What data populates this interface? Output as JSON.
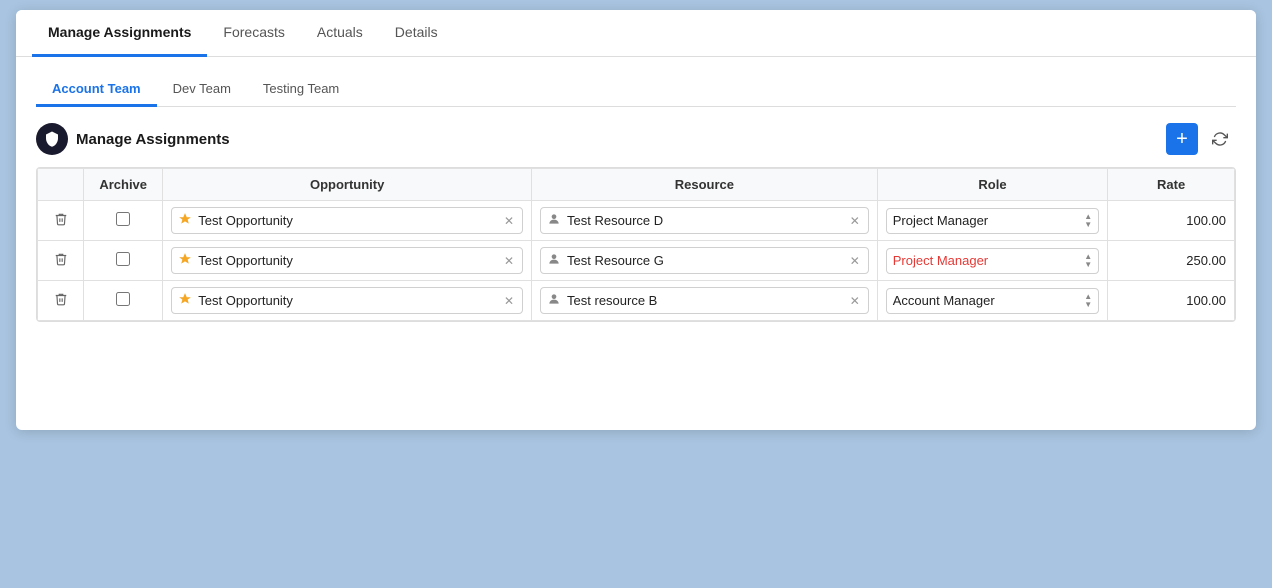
{
  "top_nav": {
    "items": [
      {
        "label": "Manage Assignments",
        "active": true
      },
      {
        "label": "Forecasts",
        "active": false
      },
      {
        "label": "Actuals",
        "active": false
      },
      {
        "label": "Details",
        "active": false
      }
    ]
  },
  "sub_tabs": {
    "items": [
      {
        "label": "Account Team",
        "active": true
      },
      {
        "label": "Dev Team",
        "active": false
      },
      {
        "label": "Testing Team",
        "active": false
      }
    ]
  },
  "section": {
    "title": "Manage Assignments"
  },
  "table": {
    "headers": {
      "archive": "Archive",
      "opportunity": "Opportunity",
      "resource": "Resource",
      "role": "Role",
      "rate": "Rate"
    },
    "rows": [
      {
        "opportunity": "Test Opportunity",
        "resource": "Test Resource D",
        "role": "Project Manager",
        "rate": "100.00",
        "role_error": false
      },
      {
        "opportunity": "Test Opportunity",
        "resource": "Test Resource G",
        "role": "Project Manager",
        "rate": "250.00",
        "role_error": true
      },
      {
        "opportunity": "Test Opportunity",
        "resource": "Test resource B",
        "role": "Account Manager",
        "rate": "100.00",
        "role_error": false
      }
    ]
  },
  "buttons": {
    "add": "+",
    "refresh": "↻"
  },
  "icons": {
    "shield": "🛡",
    "crown": "♛",
    "person": "👤",
    "delete": "🗑",
    "clear": "✕"
  }
}
